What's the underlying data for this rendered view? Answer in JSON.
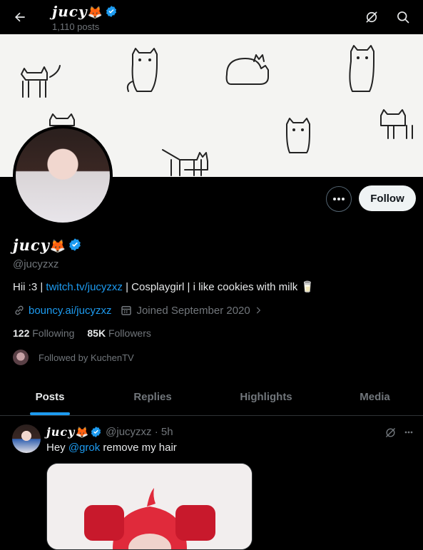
{
  "header": {
    "display_name": "jucy",
    "name_emoji": "🦊",
    "posts_count": "1,110 posts"
  },
  "profile": {
    "display_name": "jucy",
    "name_emoji": "🦊",
    "handle": "@jucyzxz",
    "bio_prefix": "Hii :3 | ",
    "bio_link": "twitch.tv/jucyzxz",
    "bio_suffix": " | Cosplaygirl | i like cookies with milk 🥛",
    "website": "bouncy.ai/jucyzxz",
    "joined": "Joined September 2020",
    "following_count": "122",
    "following_label": "Following",
    "followers_count": "85K",
    "followers_label": "Followers",
    "followed_by": "Followed by KuchenTV"
  },
  "buttons": {
    "follow": "Follow"
  },
  "tabs": [
    {
      "label": "Posts",
      "active": true
    },
    {
      "label": "Replies",
      "active": false
    },
    {
      "label": "Highlights",
      "active": false
    },
    {
      "label": "Media",
      "active": false
    }
  ],
  "tweet": {
    "display_name": "jucy",
    "name_emoji": "🦊",
    "handle_time": "@jucyzxz · 5h",
    "text_prefix": "Hey ",
    "mention": "@grok",
    "text_suffix": " remove my hair"
  },
  "colors": {
    "accent": "#1d9bf0",
    "background": "#000000",
    "muted": "#71767b"
  },
  "icons": [
    "back-arrow-icon",
    "grok-icon",
    "search-icon",
    "more-icon",
    "link-icon",
    "calendar-icon",
    "chevron-right-icon",
    "verified-badge-icon"
  ]
}
